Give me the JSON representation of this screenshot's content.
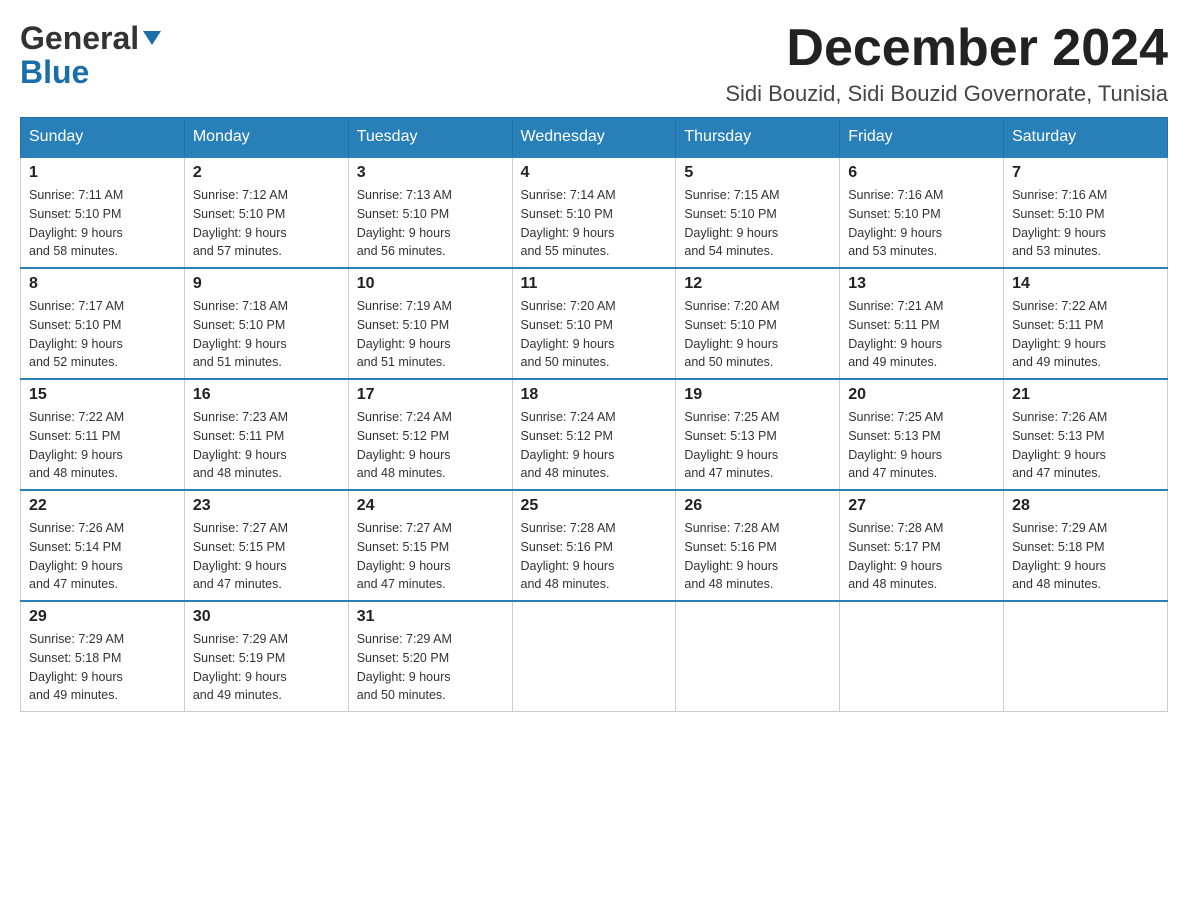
{
  "logo": {
    "line1": "General",
    "triangle": "▶",
    "line2": "Blue"
  },
  "title": "December 2024",
  "subtitle": "Sidi Bouzid, Sidi Bouzid Governorate, Tunisia",
  "weekdays": [
    "Sunday",
    "Monday",
    "Tuesday",
    "Wednesday",
    "Thursday",
    "Friday",
    "Saturday"
  ],
  "weeks": [
    [
      {
        "day": "1",
        "sunrise": "7:11 AM",
        "sunset": "5:10 PM",
        "daylight": "9 hours and 58 minutes."
      },
      {
        "day": "2",
        "sunrise": "7:12 AM",
        "sunset": "5:10 PM",
        "daylight": "9 hours and 57 minutes."
      },
      {
        "day": "3",
        "sunrise": "7:13 AM",
        "sunset": "5:10 PM",
        "daylight": "9 hours and 56 minutes."
      },
      {
        "day": "4",
        "sunrise": "7:14 AM",
        "sunset": "5:10 PM",
        "daylight": "9 hours and 55 minutes."
      },
      {
        "day": "5",
        "sunrise": "7:15 AM",
        "sunset": "5:10 PM",
        "daylight": "9 hours and 54 minutes."
      },
      {
        "day": "6",
        "sunrise": "7:16 AM",
        "sunset": "5:10 PM",
        "daylight": "9 hours and 53 minutes."
      },
      {
        "day": "7",
        "sunrise": "7:16 AM",
        "sunset": "5:10 PM",
        "daylight": "9 hours and 53 minutes."
      }
    ],
    [
      {
        "day": "8",
        "sunrise": "7:17 AM",
        "sunset": "5:10 PM",
        "daylight": "9 hours and 52 minutes."
      },
      {
        "day": "9",
        "sunrise": "7:18 AM",
        "sunset": "5:10 PM",
        "daylight": "9 hours and 51 minutes."
      },
      {
        "day": "10",
        "sunrise": "7:19 AM",
        "sunset": "5:10 PM",
        "daylight": "9 hours and 51 minutes."
      },
      {
        "day": "11",
        "sunrise": "7:20 AM",
        "sunset": "5:10 PM",
        "daylight": "9 hours and 50 minutes."
      },
      {
        "day": "12",
        "sunrise": "7:20 AM",
        "sunset": "5:10 PM",
        "daylight": "9 hours and 50 minutes."
      },
      {
        "day": "13",
        "sunrise": "7:21 AM",
        "sunset": "5:11 PM",
        "daylight": "9 hours and 49 minutes."
      },
      {
        "day": "14",
        "sunrise": "7:22 AM",
        "sunset": "5:11 PM",
        "daylight": "9 hours and 49 minutes."
      }
    ],
    [
      {
        "day": "15",
        "sunrise": "7:22 AM",
        "sunset": "5:11 PM",
        "daylight": "9 hours and 48 minutes."
      },
      {
        "day": "16",
        "sunrise": "7:23 AM",
        "sunset": "5:11 PM",
        "daylight": "9 hours and 48 minutes."
      },
      {
        "day": "17",
        "sunrise": "7:24 AM",
        "sunset": "5:12 PM",
        "daylight": "9 hours and 48 minutes."
      },
      {
        "day": "18",
        "sunrise": "7:24 AM",
        "sunset": "5:12 PM",
        "daylight": "9 hours and 48 minutes."
      },
      {
        "day": "19",
        "sunrise": "7:25 AM",
        "sunset": "5:13 PM",
        "daylight": "9 hours and 47 minutes."
      },
      {
        "day": "20",
        "sunrise": "7:25 AM",
        "sunset": "5:13 PM",
        "daylight": "9 hours and 47 minutes."
      },
      {
        "day": "21",
        "sunrise": "7:26 AM",
        "sunset": "5:13 PM",
        "daylight": "9 hours and 47 minutes."
      }
    ],
    [
      {
        "day": "22",
        "sunrise": "7:26 AM",
        "sunset": "5:14 PM",
        "daylight": "9 hours and 47 minutes."
      },
      {
        "day": "23",
        "sunrise": "7:27 AM",
        "sunset": "5:15 PM",
        "daylight": "9 hours and 47 minutes."
      },
      {
        "day": "24",
        "sunrise": "7:27 AM",
        "sunset": "5:15 PM",
        "daylight": "9 hours and 47 minutes."
      },
      {
        "day": "25",
        "sunrise": "7:28 AM",
        "sunset": "5:16 PM",
        "daylight": "9 hours and 48 minutes."
      },
      {
        "day": "26",
        "sunrise": "7:28 AM",
        "sunset": "5:16 PM",
        "daylight": "9 hours and 48 minutes."
      },
      {
        "day": "27",
        "sunrise": "7:28 AM",
        "sunset": "5:17 PM",
        "daylight": "9 hours and 48 minutes."
      },
      {
        "day": "28",
        "sunrise": "7:29 AM",
        "sunset": "5:18 PM",
        "daylight": "9 hours and 48 minutes."
      }
    ],
    [
      {
        "day": "29",
        "sunrise": "7:29 AM",
        "sunset": "5:18 PM",
        "daylight": "9 hours and 49 minutes."
      },
      {
        "day": "30",
        "sunrise": "7:29 AM",
        "sunset": "5:19 PM",
        "daylight": "9 hours and 49 minutes."
      },
      {
        "day": "31",
        "sunrise": "7:29 AM",
        "sunset": "5:20 PM",
        "daylight": "9 hours and 50 minutes."
      },
      null,
      null,
      null,
      null
    ]
  ],
  "labels": {
    "sunrise": "Sunrise:",
    "sunset": "Sunset:",
    "daylight": "Daylight:"
  }
}
